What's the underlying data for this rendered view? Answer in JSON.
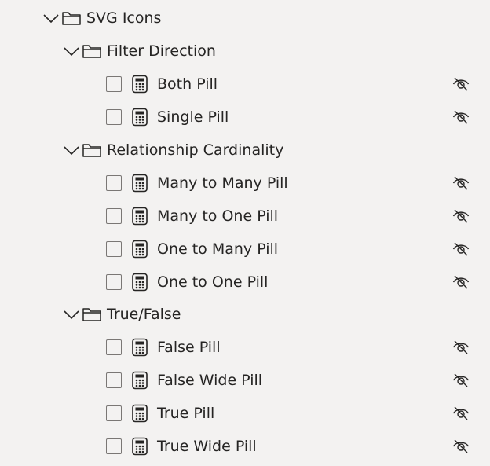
{
  "root": {
    "label": "SVG Icons",
    "groups": [
      {
        "label": "Filter Direction",
        "items": [
          {
            "label": "Both Pill"
          },
          {
            "label": "Single Pill"
          }
        ]
      },
      {
        "label": "Relationship Cardinality",
        "items": [
          {
            "label": "Many to Many Pill"
          },
          {
            "label": "Many to One Pill"
          },
          {
            "label": "One to Many Pill"
          },
          {
            "label": "One to One Pill"
          }
        ]
      },
      {
        "label": "True/False",
        "items": [
          {
            "label": "False Pill"
          },
          {
            "label": "False Wide Pill"
          },
          {
            "label": "True Pill"
          },
          {
            "label": "True Wide Pill"
          }
        ]
      }
    ]
  },
  "icons": {
    "expand": "chevron-down-icon",
    "folder": "folder-icon",
    "measure": "calculator-icon",
    "hidden": "eye-hidden-icon"
  },
  "colors": {
    "background": "#f3f2f1",
    "text": "#252423",
    "icon": "#252423",
    "checkbox_border": "#7a7775"
  }
}
